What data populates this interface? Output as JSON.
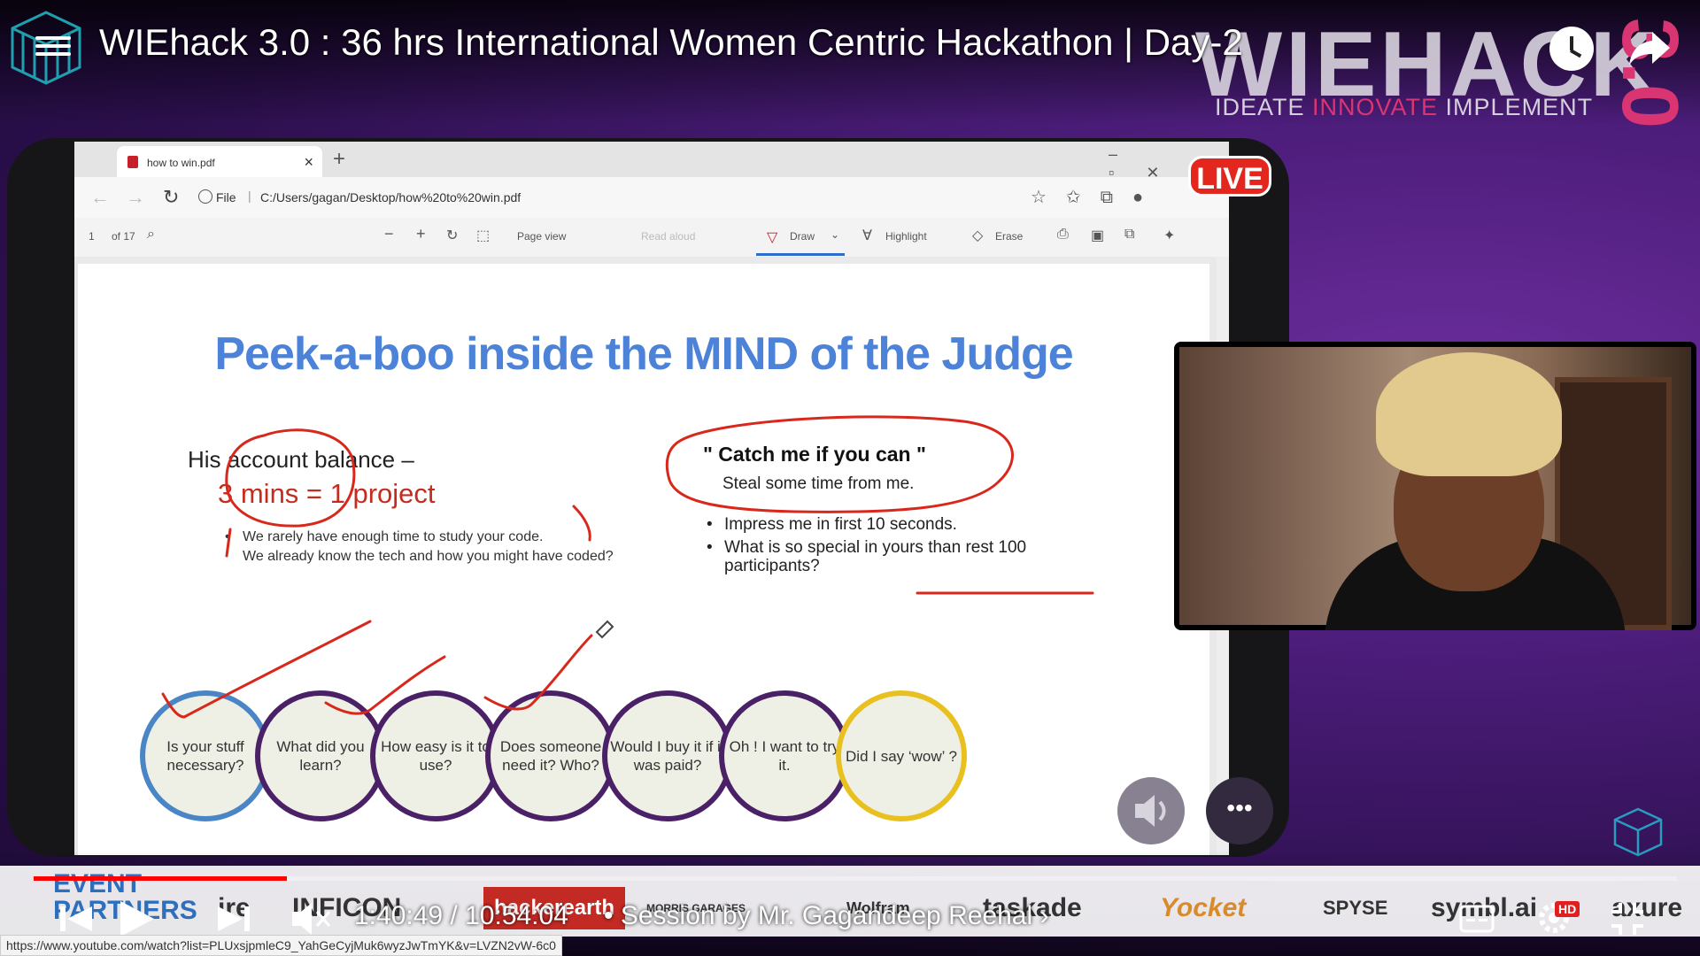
{
  "player": {
    "video_title": "WIEhack 3.0 : 36 hrs International Women Centric Hackathon | Day-2",
    "time_current": "1:40:49",
    "time_total": "10:54:04",
    "time_separator": " / ",
    "chapter": "• Session by Mr. Gagandeep Reehal",
    "chapter_arrow": "›",
    "progress_fraction": 0.154,
    "hd_label": "HD",
    "live_label": "LIVE",
    "status_url": "https://www.youtube.com/watch?list=PLUxsjpmleC9_YahGeCyjMuk6wyzJwTmYK&v=LVZN2vW-6c0",
    "more_label": "•••"
  },
  "brand": {
    "name": "WIEHACK",
    "version": "3.0",
    "tagline_1": "IDEATE ",
    "tagline_2": "INNOVATE",
    "tagline_3": " IMPLEMENT"
  },
  "browser": {
    "tab_title": "how to win.pdf",
    "tab_close": "×",
    "new_tab": "+",
    "file_label": "File",
    "url": "C:/Users/gagan/Desktop/how%20to%20win.pdf",
    "page_number": "1",
    "page_count": "of 17",
    "toolbar": {
      "page_view": "Page view",
      "read_aloud": "Read aloud",
      "draw": "Draw",
      "highlight": "Highlight",
      "erase": "Erase"
    }
  },
  "slide": {
    "title": "Peek-a-boo inside the MIND of the Judge",
    "balance_label": "His account balance –",
    "balance_value": "3 mins = 1 project",
    "note1": "We rarely have enough time to study your code.",
    "note2": "We already know the tech and how you might have coded?",
    "catch_title": "\" Catch me if you can \"",
    "catch_sub": "Steal some time from me.",
    "bullet1": "Impress me in first 10 seconds.",
    "bullet2": "What is so special in yours than rest 100 participants?",
    "bullet_char": "•",
    "steps": [
      "Is your stuff necessary?",
      "What did you learn?",
      "How easy is it to use?",
      "Does someone need it? Who?",
      "Would I buy it if it was paid?",
      "Oh ! I want to try it.",
      "Did I say ‘wow’ ?"
    ],
    "step_colors": [
      "#4a86c6",
      "#4a2066",
      "#4a2066",
      "#4a2066",
      "#4a2066",
      "#4a2066",
      "#e8c020"
    ]
  },
  "partners": {
    "label_1": "EVENT",
    "label_2": "PARTNERS",
    "logos": [
      "ire",
      "INFICON",
      "hackerearth",
      "MORRIS GARAGES",
      "Wolfram",
      "taskade",
      "Yocket",
      "SPYSE",
      "symbl.ai",
      "axure"
    ]
  }
}
